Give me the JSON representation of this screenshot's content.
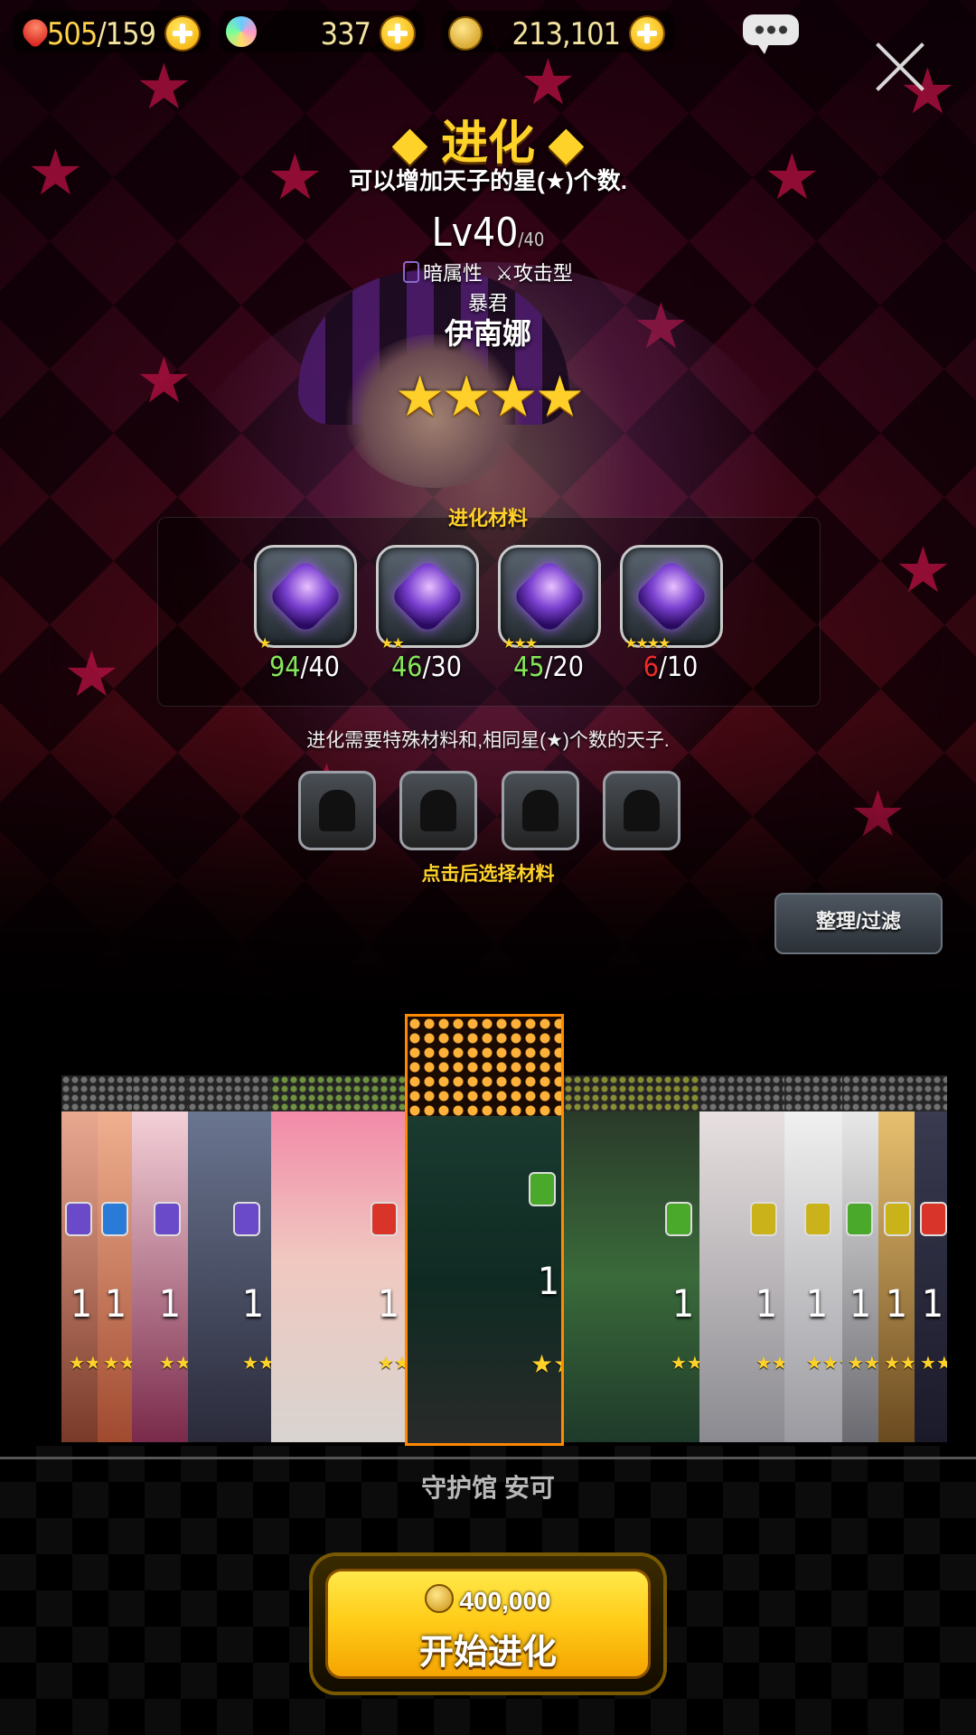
{
  "top_bar": {
    "stamina": {
      "current": "505",
      "max": "/159"
    },
    "gems": {
      "value": "337"
    },
    "gold": {
      "value": "213,101"
    }
  },
  "header": {
    "title": "◆ 进化 ◆",
    "subtitle": "可以增加天子的星(★)个数.",
    "level": "Lv40",
    "level_max": "/40",
    "element": "暗属性",
    "role": "攻击型",
    "epithet": "暴君",
    "name": "伊南娜",
    "stars": "★★★★"
  },
  "materials": {
    "title": "进化材料",
    "items": [
      {
        "stars": "★",
        "have": "94",
        "need": "/40",
        "enough": true
      },
      {
        "stars": "★★",
        "have": "46",
        "need": "/30",
        "enough": true
      },
      {
        "stars": "★★★",
        "have": "45",
        "need": "/20",
        "enough": true
      },
      {
        "stars": "★★★★",
        "have": "6",
        "need": "/10",
        "enough": false
      }
    ]
  },
  "requirement_hint": "进化需要特殊材料和,相同星(★)个数的天子.",
  "select_hint": "点击后选择材料",
  "filter_button": "整理/过滤",
  "characters": [
    {
      "level": "1",
      "stars": "★★★★",
      "element_color": "#6a4ac8"
    },
    {
      "level": "1",
      "stars": "★★★★",
      "element_color": "#2a7ad8"
    },
    {
      "level": "1",
      "stars": "★★★★",
      "element_color": "#6a4ac8"
    },
    {
      "level": "1",
      "stars": "★★★★",
      "element_color": "#6a4ac8"
    },
    {
      "level": "1",
      "stars": "★★★★",
      "element_color": "#d8342a"
    },
    {
      "level": "1",
      "stars": "★★★★",
      "element_color": "#4aa82a"
    },
    {
      "level": "1",
      "stars": "★★★★",
      "element_color": "#4aa82a"
    },
    {
      "level": "1",
      "stars": "★★★★",
      "element_color": "#c9b21a"
    },
    {
      "level": "1",
      "stars": "★★★★",
      "element_color": "#c9b21a"
    },
    {
      "level": "1",
      "stars": "★★★★",
      "element_color": "#4aa82a"
    },
    {
      "level": "1",
      "stars": "★★★★",
      "element_color": "#c9b21a"
    },
    {
      "level": "1",
      "stars": "★★★★",
      "element_color": "#d8342a"
    }
  ],
  "selected_character_name": "守护馆 安可",
  "start_button": {
    "cost": "400,000",
    "label": "开始进化"
  }
}
